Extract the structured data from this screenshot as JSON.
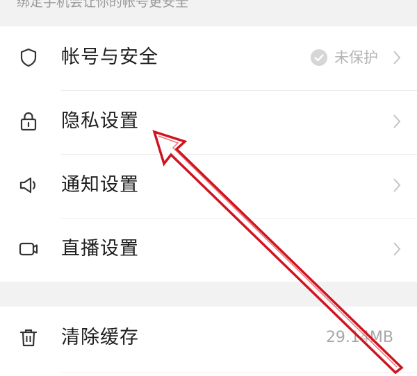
{
  "hint": {
    "text": "绑定手机会让你的帐号更安全"
  },
  "settings": {
    "account_security": {
      "label": "帐号与安全",
      "status": "未保护"
    },
    "privacy": {
      "label": "隐私设置"
    },
    "notifications": {
      "label": "通知设置"
    },
    "live": {
      "label": "直播设置"
    },
    "clear_cache": {
      "label": "清除缓存",
      "value": "29.14MB"
    }
  },
  "icons": {
    "account_security": "shield-icon",
    "privacy": "lock-icon",
    "notifications": "speaker-icon",
    "live": "video-camera-icon",
    "clear_cache": "trash-icon",
    "status": "check-circle-icon",
    "chevron": "chevron-right-icon"
  },
  "colors": {
    "annotation_arrow": "#d0121b",
    "background": "#f2f2f2",
    "card": "#ffffff"
  }
}
